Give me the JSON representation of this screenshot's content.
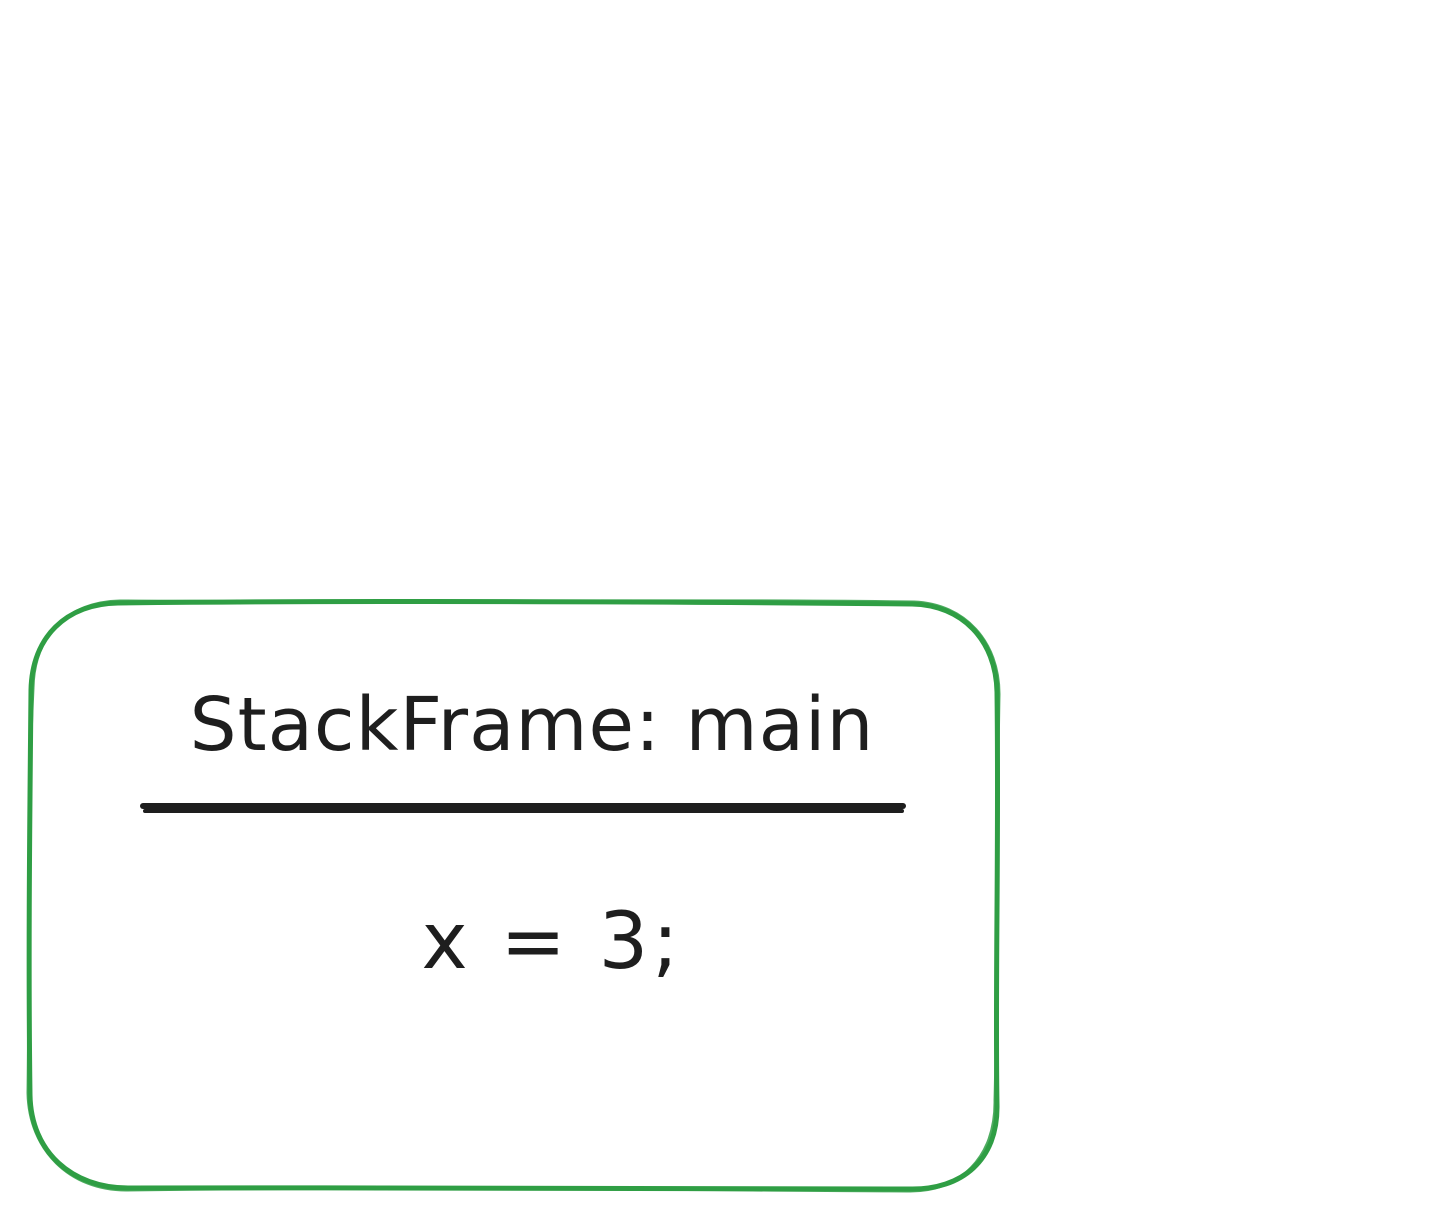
{
  "stack_frame": {
    "title": "StackFrame: main",
    "variable": "x = 3;"
  },
  "colors": {
    "frame_border": "#2f9e44",
    "ink": "#1e1e1e",
    "background": "#ffffff"
  }
}
